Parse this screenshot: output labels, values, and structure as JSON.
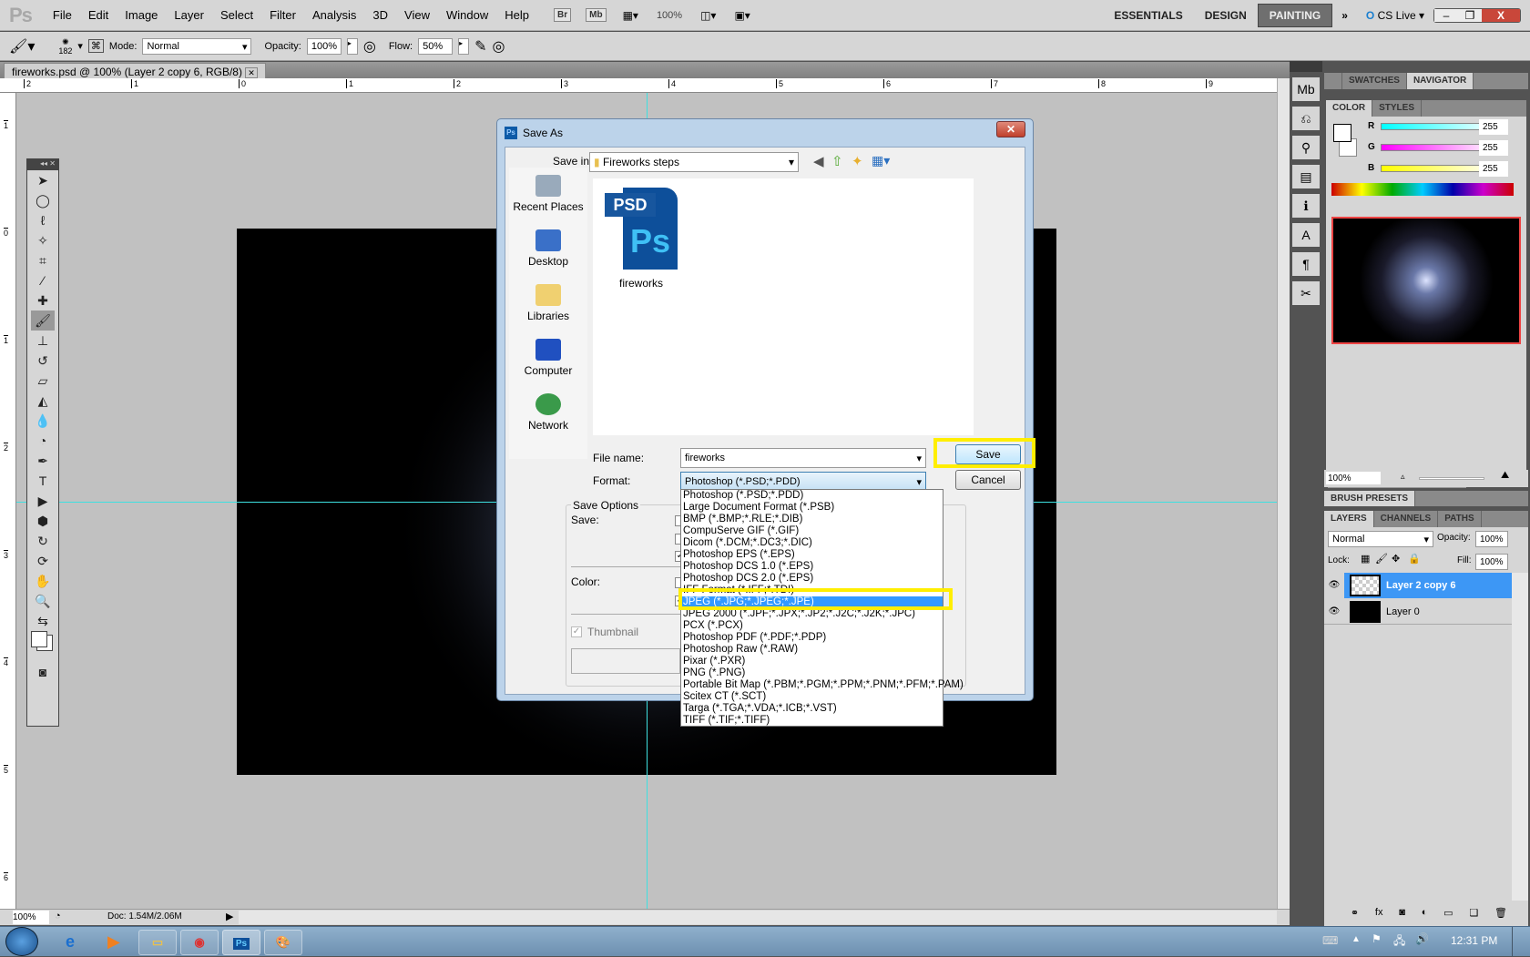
{
  "app": {
    "logo": "Ps",
    "menu": [
      "File",
      "Edit",
      "Image",
      "Layer",
      "Select",
      "Filter",
      "Analysis",
      "3D",
      "View",
      "Window",
      "Help"
    ],
    "bridge": "Br",
    "minibridge": "Mb",
    "zoom": "100%",
    "workspaces": [
      "ESSENTIALS",
      "DESIGN",
      "PAINTING"
    ],
    "active_workspace": "PAINTING",
    "cslive": "CS Live"
  },
  "options": {
    "brush_size": "182",
    "mode_label": "Mode:",
    "mode": "Normal",
    "opacity_label": "Opacity:",
    "opacity": "100%",
    "flow_label": "Flow:",
    "flow": "50%"
  },
  "document": {
    "tab": "fireworks.psd @ 100% (Layer 2 copy 6, RGB/8)",
    "zoom": "100%",
    "doc_size": "Doc: 1.54M/2.06M"
  },
  "rulers": {
    "top": [
      "2",
      "1",
      "0",
      "1",
      "2",
      "3",
      "4",
      "5",
      "6",
      "7",
      "8",
      "9"
    ],
    "left": [
      "1",
      "0",
      "1",
      "2",
      "3",
      "4",
      "5",
      "6"
    ]
  },
  "panels": {
    "top_tabs": [
      "SWATCHES",
      "NAVIGATOR"
    ],
    "color_tabs": [
      "COLOR",
      "STYLES"
    ],
    "rgb": [
      {
        "ch": "R",
        "v": "255"
      },
      {
        "ch": "G",
        "v": "255"
      },
      {
        "ch": "B",
        "v": "255"
      }
    ],
    "nav_zoom": "100%",
    "brush_presets": "BRUSH PRESETS",
    "layer_tabs": [
      "LAYERS",
      "CHANNELS",
      "PATHS"
    ],
    "blend": "Normal",
    "opacity_label": "Opacity:",
    "opacity": "100%",
    "lock_label": "Lock:",
    "fill_label": "Fill:",
    "fill": "100%",
    "layers": [
      {
        "name": "Layer 2 copy 6",
        "selected": true
      },
      {
        "name": "Layer 0",
        "selected": false
      }
    ]
  },
  "dialog": {
    "title": "Save As",
    "save_in_label": "Save in:",
    "save_in": "Fireworks steps",
    "places": [
      "Recent Places",
      "Desktop",
      "Libraries",
      "Computer",
      "Network"
    ],
    "files": [
      {
        "name": "fireworks",
        "badge": "PSD",
        "icon": "Ps"
      }
    ],
    "file_name_label": "File name:",
    "file_name": "fireworks",
    "format_label": "Format:",
    "format": "Photoshop (*.PSD;*.PDD)",
    "save": "Save",
    "cancel": "Cancel",
    "save_options": "Save Options",
    "save_label": "Save:",
    "color_label": "Color:",
    "thumbnail": "Thumbnail",
    "formats": [
      "Photoshop (*.PSD;*.PDD)",
      "Large Document Format (*.PSB)",
      "BMP (*.BMP;*.RLE;*.DIB)",
      "CompuServe GIF (*.GIF)",
      "Dicom (*.DCM;*.DC3;*.DIC)",
      "Photoshop EPS (*.EPS)",
      "Photoshop DCS 1.0 (*.EPS)",
      "Photoshop DCS 2.0 (*.EPS)",
      "IFF Format (*.IFF;*.TDI)",
      "JPEG (*.JPG;*.JPEG;*.JPE)",
      "JPEG 2000 (*.JPF;*.JPX;*.JP2;*.J2C;*.J2K;*.JPC)",
      "PCX (*.PCX)",
      "Photoshop PDF (*.PDF;*.PDP)",
      "Photoshop Raw (*.RAW)",
      "Pixar (*.PXR)",
      "PNG (*.PNG)",
      "Portable Bit Map (*.PBM;*.PGM;*.PPM;*.PNM;*.PFM;*.PAM)",
      "Scitex CT (*.SCT)",
      "Targa (*.TGA;*.VDA;*.ICB;*.VST)",
      "TIFF (*.TIF;*.TIFF)"
    ],
    "selected_format": "JPEG (*.JPG;*.JPEG;*.JPE)"
  },
  "highlight_color": "#ffee00",
  "taskbar": {
    "time": "12:31 PM",
    "apps": [
      "internet-explorer",
      "media-player",
      "explorer",
      "chrome",
      "photoshop",
      "paint"
    ],
    "ps_label": "Ps"
  }
}
